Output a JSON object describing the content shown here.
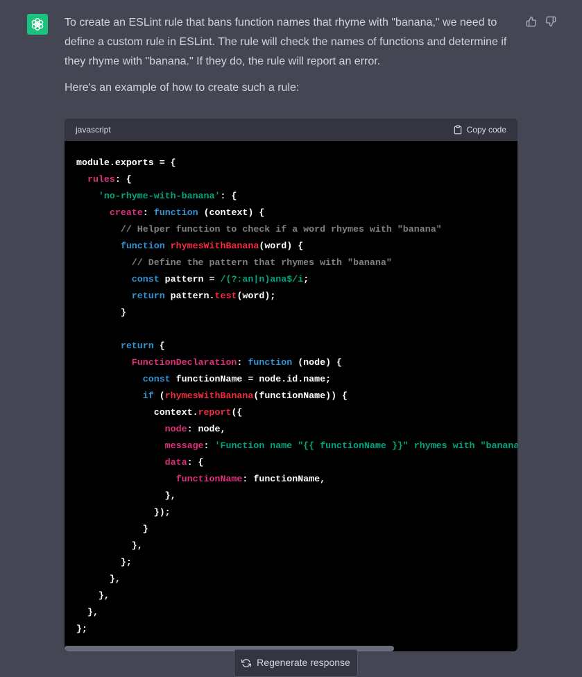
{
  "message": {
    "paragraphs": [
      "To create an ESLint rule that bans function names that rhyme with \"banana,\" we need to define a custom rule in ESLint. The rule will check the names of functions and determine if they rhyme with \"banana.\" If they do, the rule will report an error.",
      "Here's an example of how to create such a rule:"
    ]
  },
  "code_block": {
    "language": "javascript",
    "copy_label": "Copy code",
    "code": "module.exports = {\n  rules: {\n    'no-rhyme-with-banana': {\n      create: function (context) {\n        // Helper function to check if a word rhymes with \"banana\"\n        function rhymesWithBanana(word) {\n          // Define the pattern that rhymes with \"banana\"\n          const pattern = /(?:an|n)ana$/i;\n          return pattern.test(word);\n        }\n\n        return {\n          FunctionDeclaration: function (node) {\n            const functionName = node.id.name;\n            if (rhymesWithBanana(functionName)) {\n              context.report({\n                node: node,\n                message: 'Function name \"{{ functionName }}\" rhymes with \"banana\"',\n                data: {\n                  functionName: functionName,\n                },\n              });\n            }\n          },\n        };\n      },\n    },\n  },\n};"
  },
  "regenerate_label": "Regenerate response",
  "icons": {
    "avatar": "openai-logo-icon",
    "like": "thumbs-up-icon",
    "dislike": "thumbs-down-icon",
    "copy": "clipboard-icon",
    "regenerate": "refresh-icon"
  },
  "colors": {
    "background": "#444654",
    "avatar": "#19c37d",
    "code_background": "#000000",
    "code_header": "#343541",
    "keyword": "#2e95d3",
    "property": "#df3079",
    "function": "#f22c3d",
    "string": "#00a67d"
  }
}
